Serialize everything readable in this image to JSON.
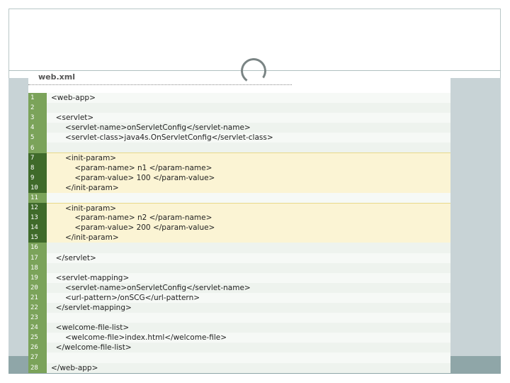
{
  "file": {
    "name": "web.xml"
  },
  "code_lines": [
    {
      "n": "1",
      "text": "<web-app>",
      "hl": false
    },
    {
      "n": "2",
      "text": "",
      "hl": false
    },
    {
      "n": "3",
      "text": "  <servlet>",
      "hl": false
    },
    {
      "n": "4",
      "text": "      <servlet-name>onServletConfig</servlet-name>",
      "hl": false
    },
    {
      "n": "5",
      "text": "      <servlet-class>java4s.OnServletConfig</servlet-class>",
      "hl": false
    },
    {
      "n": "6",
      "text": "",
      "hl": false
    },
    {
      "n": "7",
      "text": "      <init-param>",
      "hl": true
    },
    {
      "n": "8",
      "text": "          <param-name> n1 </param-name>",
      "hl": true
    },
    {
      "n": "9",
      "text": "          <param-value> 100 </param-value>",
      "hl": true
    },
    {
      "n": "10",
      "text": "      </init-param>",
      "hl": true
    },
    {
      "n": "11",
      "text": "",
      "hl": false
    },
    {
      "n": "12",
      "text": "      <init-param>",
      "hl": true
    },
    {
      "n": "13",
      "text": "          <param-name> n2 </param-name>",
      "hl": true
    },
    {
      "n": "14",
      "text": "          <param-value> 200 </param-value>",
      "hl": true
    },
    {
      "n": "15",
      "text": "      </init-param>",
      "hl": true
    },
    {
      "n": "16",
      "text": "",
      "hl": false
    },
    {
      "n": "17",
      "text": "  </servlet>",
      "hl": false
    },
    {
      "n": "18",
      "text": "",
      "hl": false
    },
    {
      "n": "19",
      "text": "  <servlet-mapping>",
      "hl": false
    },
    {
      "n": "20",
      "text": "      <servlet-name>onServletConfig</servlet-name>",
      "hl": false
    },
    {
      "n": "21",
      "text": "      <url-pattern>/onSCG</url-pattern>",
      "hl": false
    },
    {
      "n": "22",
      "text": "  </servlet-mapping>",
      "hl": false
    },
    {
      "n": "23",
      "text": "",
      "hl": false
    },
    {
      "n": "24",
      "text": "  <welcome-file-list>",
      "hl": false
    },
    {
      "n": "25",
      "text": "      <welcome-file>index.html</welcome-file>",
      "hl": false
    },
    {
      "n": "26",
      "text": "  </welcome-file-list>",
      "hl": false
    },
    {
      "n": "27",
      "text": "",
      "hl": false
    },
    {
      "n": "28",
      "text": "</web-app>",
      "hl": false
    }
  ],
  "colors": {
    "gutter": "#7ba35a",
    "gutter_highlight": "#3f6a2a",
    "highlight_bg": "#fbf4d4",
    "band": "#c8d3d6",
    "footer": "#8fa6a8"
  },
  "icons": {
    "loading": "loading-spinner-icon"
  }
}
